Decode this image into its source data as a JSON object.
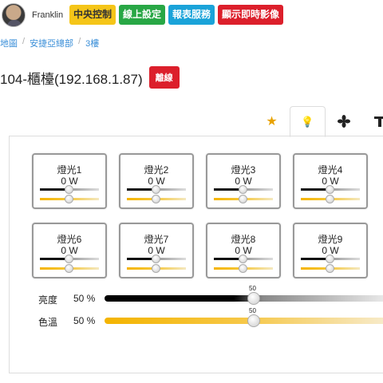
{
  "header": {
    "username": "Franklin",
    "buttons": [
      "中央控制",
      "線上設定",
      "報表服務",
      "顯示即時影像"
    ]
  },
  "breadcrumb": [
    "地圖",
    "安捷亞總部",
    "3樓"
  ],
  "page": {
    "title": "104-櫃檯(192.168.1.87)",
    "status": "離線"
  },
  "tabs": [
    {
      "name": "favorites",
      "icon": "★"
    },
    {
      "name": "lights",
      "icon": "💡"
    },
    {
      "name": "fan",
      "icon": "✢"
    },
    {
      "name": "tools",
      "icon": "⛉"
    }
  ],
  "lights": [
    {
      "name": "燈光1",
      "power": "0 W"
    },
    {
      "name": "燈光2",
      "power": "0 W"
    },
    {
      "name": "燈光3",
      "power": "0 W"
    },
    {
      "name": "燈光4",
      "power": "0 W"
    },
    {
      "name": "燈光6",
      "power": "0 W"
    },
    {
      "name": "燈光7",
      "power": "0 W"
    },
    {
      "name": "燈光8",
      "power": "0 W"
    },
    {
      "name": "燈光9",
      "power": "0 W"
    }
  ],
  "controls": {
    "brightness": {
      "label": "亮度",
      "value": "50 %",
      "tip": "50",
      "level": 50
    },
    "color_temp": {
      "label": "色溫",
      "value": "50 %",
      "tip": "50",
      "level": 50
    }
  },
  "colors": {
    "accent_blue": "#3b8fd8",
    "offline_red": "#dc1f2b",
    "warm_yellow": "#f5b400"
  }
}
